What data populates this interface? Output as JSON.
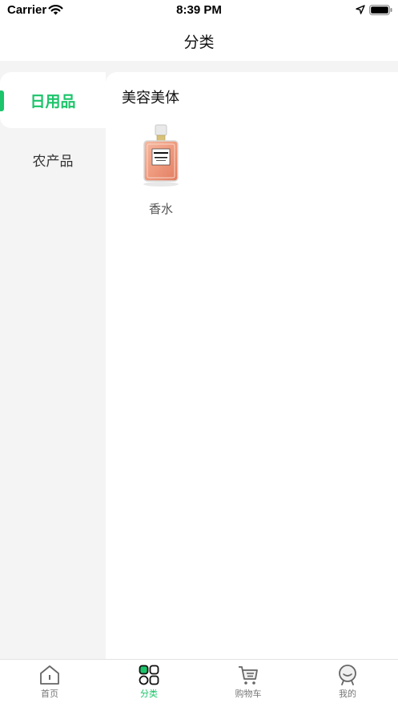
{
  "status_bar": {
    "carrier": "Carrier",
    "time": "8:39 PM"
  },
  "nav": {
    "title": "分类"
  },
  "sidebar": {
    "items": [
      {
        "label": "日用品",
        "active": true
      },
      {
        "label": "农产品",
        "active": false
      }
    ]
  },
  "main": {
    "section_title": "美容美体",
    "products": [
      {
        "name": "香水",
        "image": "perfume-bottle-icon"
      }
    ]
  },
  "tab_bar": {
    "items": [
      {
        "label": "首页",
        "icon": "home-icon",
        "active": false
      },
      {
        "label": "分类",
        "icon": "category-grid-icon",
        "active": true
      },
      {
        "label": "购物车",
        "icon": "cart-icon",
        "active": false
      },
      {
        "label": "我的",
        "icon": "profile-icon",
        "active": false
      }
    ]
  },
  "colors": {
    "accent": "#1cc46a",
    "background": "#f4f4f4",
    "text": "#222222"
  }
}
